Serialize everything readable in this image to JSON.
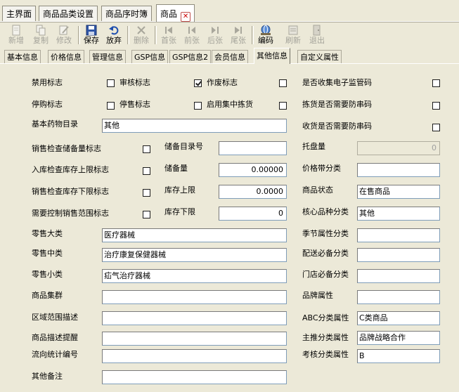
{
  "doc_tabs": [
    "主界面",
    "商品品类设置",
    "商品序时簿",
    "商品"
  ],
  "toolbar": {
    "new": "新增",
    "copy": "复制",
    "edit": "修改",
    "save": "保存",
    "discard": "放弃",
    "delete": "删除",
    "first": "首张",
    "prev": "前张",
    "next": "后张",
    "last": "尾张",
    "code": "编码",
    "refresh": "刷新",
    "exit": "退出"
  },
  "sub_tabs": [
    "基本信息",
    "价格信息",
    "管理信息",
    "GSP信息",
    "GSP信息2",
    "会员信息",
    "其他信息",
    "自定义属性"
  ],
  "sub_tab_active": "其他信息",
  "flags": {
    "disable": {
      "label": "禁用标志",
      "checked": false
    },
    "review": {
      "label": "审核标志",
      "checked": false
    },
    "void": {
      "label": "作废标志",
      "checked": true
    },
    "collect_code": {
      "label": "是否收集电子监管码",
      "checked": false
    },
    "stop_purchase": {
      "label": "停购标志",
      "checked": false
    },
    "stop_sale": {
      "label": "停售标志",
      "checked": false
    },
    "central_pick": {
      "label": "启用集中拣货",
      "checked": false
    },
    "pick_code": {
      "label": "拣货是否需要防串码",
      "checked": false
    },
    "receive_code": {
      "label": "收货是否需要防串码",
      "checked": false
    },
    "sale_check_reserve": {
      "label": "销售检查储备量标志",
      "checked": false
    },
    "in_check_upper": {
      "label": "入库检查库存上限标志",
      "checked": false
    },
    "sale_check_lower": {
      "label": "销售检查库存下限标志",
      "checked": false
    },
    "control_range": {
      "label": "需要控制销售范围标志",
      "checked": false
    }
  },
  "fields": {
    "essential_drug": {
      "label": "基本药物目录",
      "value": "其他"
    },
    "reserve_catalog": {
      "label": "储备目录号",
      "value": ""
    },
    "reserve_qty": {
      "label": "储备量",
      "value": "0.00000"
    },
    "stock_upper": {
      "label": "库存上限",
      "value": "0.0000"
    },
    "stock_lower": {
      "label": "库存下限",
      "value": "0"
    },
    "pallet": {
      "label": "托盘量",
      "value": "0"
    },
    "price_band": {
      "label": "价格带分类",
      "value": ""
    },
    "status": {
      "label": "商品状态",
      "value": "在售商品"
    },
    "core_category": {
      "label": "核心品种分类",
      "value": "其他"
    },
    "retail_major": {
      "label": "零售大类",
      "value": "医疗器械"
    },
    "retail_mid": {
      "label": "零售中类",
      "value": "治疗康复保健器械"
    },
    "retail_minor": {
      "label": "零售小类",
      "value": "疝气治疗器械"
    },
    "goods_group": {
      "label": "商品集群",
      "value": ""
    },
    "region_desc": {
      "label": "区域范围描述",
      "value": ""
    },
    "desc_reminder": {
      "label": "商品描述提醒",
      "value": ""
    },
    "flow_code": {
      "label": "流向统计编号",
      "value": ""
    },
    "other_remark": {
      "label": "其他备注",
      "value": ""
    },
    "season": {
      "label": "季节属性分类",
      "value": ""
    },
    "delivery_required": {
      "label": "配送必备分类",
      "value": ""
    },
    "store_required": {
      "label": "门店必备分类",
      "value": ""
    },
    "brand": {
      "label": "品牌属性",
      "value": ""
    },
    "abc": {
      "label": "ABC分类属性",
      "value": "C类商品"
    },
    "main_push": {
      "label": "主推分类属性",
      "value": "品牌战略合作"
    },
    "assess": {
      "label": "考核分类属性",
      "value": "B"
    }
  }
}
